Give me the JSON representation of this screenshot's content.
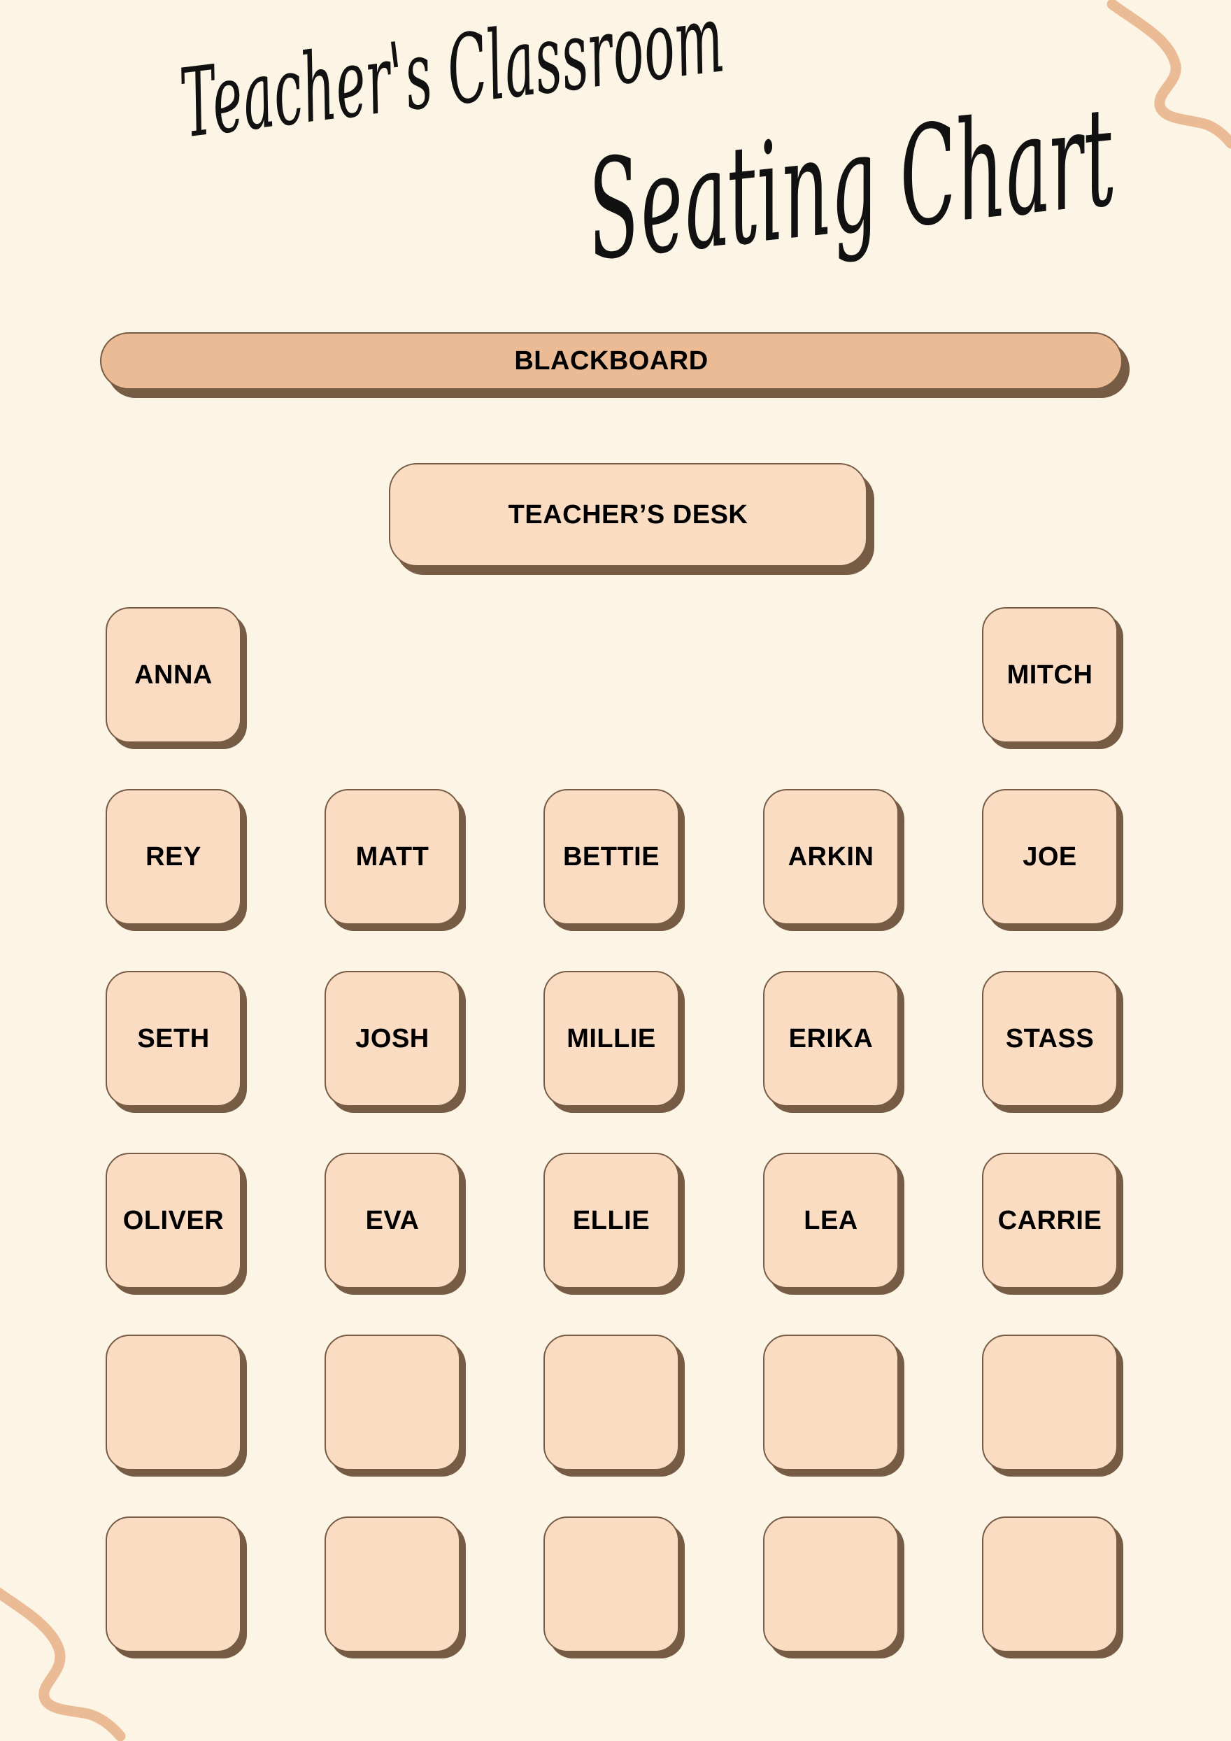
{
  "title": {
    "line1": "Teacher's Classroom",
    "line2": "Seating Chart"
  },
  "blackboard": {
    "label": "BLACKBOARD"
  },
  "teacher_desk": {
    "label": "TEACHER’S DESK"
  },
  "colors": {
    "background": "#fcf4e4",
    "blackboard": "#eabb95",
    "desk": "#fadcc3",
    "shadow": "#775c45",
    "squiggle": "#eabb95",
    "text": "#000000"
  },
  "decorations": [
    "squiggle-top-right",
    "squiggle-bottom-left"
  ],
  "seating": {
    "rows": [
      [
        "ANNA",
        null,
        null,
        null,
        "MITCH"
      ],
      [
        "REY",
        "MATT",
        "BETTIE",
        "ARKIN",
        "JOE"
      ],
      [
        "SETH",
        "JOSH",
        "MILLIE",
        "ERIKA",
        "STASS"
      ],
      [
        "OLIVER",
        "EVA",
        "ELLIE",
        "LEA",
        "CARRIE"
      ],
      [
        "",
        "",
        "",
        "",
        ""
      ],
      [
        "",
        "",
        "",
        "",
        ""
      ]
    ]
  }
}
